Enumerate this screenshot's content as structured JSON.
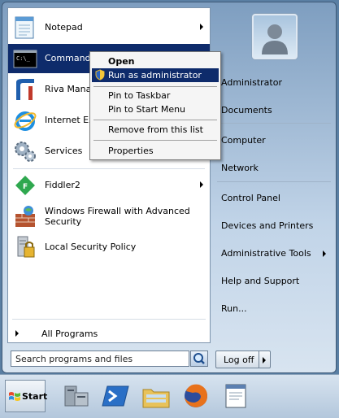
{
  "left_panel": {
    "items": [
      {
        "label": "Notepad",
        "icon": "notepad-icon",
        "submenu": true
      },
      {
        "label": "Command P",
        "icon": "command-prompt-icon",
        "submenu": true,
        "selected": true
      },
      {
        "label": "Riva Manag",
        "icon": "riva-manager-icon"
      },
      {
        "label": "Internet Exp",
        "icon": "internet-explorer-icon"
      },
      {
        "label": "Services",
        "icon": "services-gears-icon"
      },
      {
        "label": "Fiddler2",
        "icon": "fiddler-icon",
        "submenu": true
      },
      {
        "label": "Windows Firewall with Advanced Security",
        "icon": "firewall-icon"
      },
      {
        "label": "Local Security Policy",
        "icon": "security-policy-icon"
      }
    ],
    "all_programs": "All Programs"
  },
  "search": {
    "placeholder": "Search programs and files"
  },
  "right_panel": {
    "items": [
      {
        "label": "Administrator"
      },
      {
        "label": "Documents"
      },
      {
        "label": "Computer"
      },
      {
        "label": "Network"
      },
      {
        "label": "Control Panel"
      },
      {
        "label": "Devices and Printers"
      },
      {
        "label": "Administrative Tools",
        "submenu": true
      },
      {
        "label": "Help and Support"
      },
      {
        "label": "Run..."
      }
    ]
  },
  "logoff": {
    "label": "Log off"
  },
  "context_menu": {
    "items": [
      {
        "label": "Open",
        "bold": true
      },
      {
        "label": "Run as administrator",
        "icon": "uac-shield-icon",
        "highlighted": true
      },
      {
        "label": "Pin to Taskbar"
      },
      {
        "label": "Pin to Start Menu"
      },
      {
        "label": "Remove from this list"
      },
      {
        "label": "Properties"
      }
    ]
  },
  "taskbar": {
    "start_label": "Start",
    "pinned": [
      "server-manager-icon",
      "powershell-icon",
      "explorer-folder-icon",
      "firefox-icon",
      "notepad-window-icon"
    ]
  },
  "colors": {
    "selection": "#0e2b6b",
    "menu_frame": "#7e9ec0",
    "taskbar": "#c5d6e8"
  }
}
